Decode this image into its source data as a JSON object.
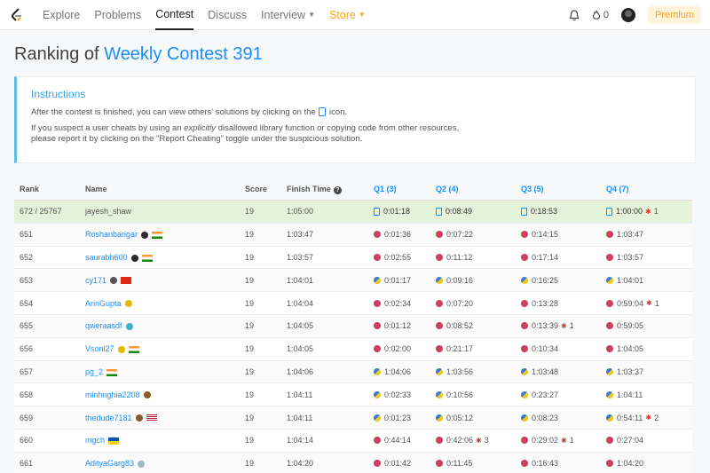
{
  "nav": {
    "items": [
      {
        "label": "Explore",
        "active": false
      },
      {
        "label": "Problems",
        "active": false
      },
      {
        "label": "Contest",
        "active": true
      },
      {
        "label": "Discuss",
        "active": false
      },
      {
        "label": "Interview",
        "dropdown": true
      },
      {
        "label": "Store",
        "dropdown": true
      }
    ],
    "fire_count": "0",
    "premium_label": "Premium"
  },
  "page": {
    "title_prefix": "Ranking of ",
    "contest_name": "Weekly Contest 391"
  },
  "instructions": {
    "heading": "Instructions",
    "line1_before": "After the contest is finished, you can view others' solutions by clicking on the ",
    "line1_after": " icon.",
    "line2_before": "If you suspect a user cheats by using an ",
    "line2_em": "explicitly",
    "line2_after": " disallowed library function or copying code from other resources,",
    "line3": "please report it by clicking on the \"Report Cheating\" toggle under the suspicious solution."
  },
  "table": {
    "headers": {
      "rank": "Rank",
      "name": "Name",
      "score": "Score",
      "finish": "Finish Time",
      "q1": "Q1 (3)",
      "q2": "Q2 (4)",
      "q3": "Q3 (5)",
      "q4": "Q4 (7)"
    },
    "rows": [
      {
        "rank": "672 / 25767",
        "name": "jayesh_shaw",
        "me": true,
        "score": "19",
        "finish": "1:05:00",
        "q1": {
          "t": "0:01:18",
          "lang": "doc"
        },
        "q2": {
          "t": "0:08:49",
          "lang": "doc"
        },
        "q3": {
          "t": "0:18:53",
          "lang": "doc"
        },
        "q4": {
          "t": "1:00:00",
          "lang": "doc",
          "bugs": "1"
        }
      },
      {
        "rank": "651",
        "name": "Roshanbangar",
        "badge": "#2c2c2c",
        "flag": "in",
        "score": "19",
        "finish": "1:03:47",
        "q1": {
          "t": "0:01:36",
          "lang": "cpp"
        },
        "q2": {
          "t": "0:07:22",
          "lang": "cpp"
        },
        "q3": {
          "t": "0:14:15",
          "lang": "cpp"
        },
        "q4": {
          "t": "1:03:47",
          "lang": "cpp"
        }
      },
      {
        "rank": "652",
        "name": "saurabh600",
        "badge": "#2c2c2c",
        "flag": "in",
        "score": "19",
        "finish": "1:03:57",
        "q1": {
          "t": "0:02:55",
          "lang": "cpp"
        },
        "q2": {
          "t": "0:11:12",
          "lang": "cpp"
        },
        "q3": {
          "t": "0:17:14",
          "lang": "cpp"
        },
        "q4": {
          "t": "1:03:57",
          "lang": "cpp"
        }
      },
      {
        "rank": "653",
        "name": "cy171",
        "badge": "#555",
        "flag": "cn",
        "score": "19",
        "finish": "1:04:01",
        "q1": {
          "t": "0:01:17",
          "lang": "py"
        },
        "q2": {
          "t": "0:09:16",
          "lang": "py"
        },
        "q3": {
          "t": "0:16:25",
          "lang": "py"
        },
        "q4": {
          "t": "1:04:01",
          "lang": "py"
        }
      },
      {
        "rank": "654",
        "name": "ArinGupta",
        "badge": "#e6b800",
        "flag": "",
        "score": "19",
        "finish": "1:04:04",
        "q1": {
          "t": "0:02:34",
          "lang": "cpp"
        },
        "q2": {
          "t": "0:07:20",
          "lang": "cpp"
        },
        "q3": {
          "t": "0:13:28",
          "lang": "cpp"
        },
        "q4": {
          "t": "0:59:04",
          "lang": "cpp",
          "bugs": "1"
        }
      },
      {
        "rank": "655",
        "name": "qweraasdf",
        "badge": "#3ab0c9",
        "flag": "",
        "score": "19",
        "finish": "1:04:05",
        "q1": {
          "t": "0:01:12",
          "lang": "cpp"
        },
        "q2": {
          "t": "0:08:52",
          "lang": "cpp"
        },
        "q3": {
          "t": "0:13:39",
          "lang": "cpp",
          "bugs": "1"
        },
        "q4": {
          "t": "0:59:05",
          "lang": "cpp"
        }
      },
      {
        "rank": "656",
        "name": "Vsoni27",
        "badge": "#e6b800",
        "flag": "in",
        "score": "19",
        "finish": "1:04:05",
        "q1": {
          "t": "0:02:00",
          "lang": "cpp"
        },
        "q2": {
          "t": "0:21:17",
          "lang": "cpp"
        },
        "q3": {
          "t": "0:10:34",
          "lang": "cpp"
        },
        "q4": {
          "t": "1:04:05",
          "lang": "cpp"
        }
      },
      {
        "rank": "657",
        "name": "pg_2",
        "badge": "",
        "flag": "in",
        "score": "19",
        "finish": "1:04:06",
        "q1": {
          "t": "1:04:06",
          "lang": "py"
        },
        "q2": {
          "t": "1:03:56",
          "lang": "py"
        },
        "q3": {
          "t": "1:03:48",
          "lang": "py"
        },
        "q4": {
          "t": "1:03:37",
          "lang": "py"
        }
      },
      {
        "rank": "658",
        "name": "minhnghia2208",
        "badge": "#8a5a2b",
        "flag": "",
        "score": "19",
        "finish": "1:04:11",
        "q1": {
          "t": "0:02:33",
          "lang": "py"
        },
        "q2": {
          "t": "0:10:56",
          "lang": "py"
        },
        "q3": {
          "t": "0:23:27",
          "lang": "py"
        },
        "q4": {
          "t": "1:04:11",
          "lang": "py"
        }
      },
      {
        "rank": "659",
        "name": "thedude7181",
        "badge": "#8a5a2b",
        "flag": "us",
        "score": "19",
        "finish": "1:04:11",
        "q1": {
          "t": "0:01:23",
          "lang": "py"
        },
        "q2": {
          "t": "0:05:12",
          "lang": "py"
        },
        "q3": {
          "t": "0:08:23",
          "lang": "py"
        },
        "q4": {
          "t": "0:54:11",
          "lang": "py",
          "bugs": "2"
        }
      },
      {
        "rank": "660",
        "name": "mgch",
        "badge": "",
        "flag": "ua",
        "score": "19",
        "finish": "1:04:14",
        "q1": {
          "t": "0:44:14",
          "lang": "cpp"
        },
        "q2": {
          "t": "0:42:06",
          "lang": "cpp",
          "bugs": "3"
        },
        "q3": {
          "t": "0:29:02",
          "lang": "cpp",
          "bugs": "1"
        },
        "q4": {
          "t": "0:27:04",
          "lang": "cpp"
        }
      },
      {
        "rank": "661",
        "name": "AdityaGarg83",
        "badge": "#9bb",
        "flag": "",
        "score": "19",
        "finish": "1:04:20",
        "q1": {
          "t": "0:01:42",
          "lang": "cpp"
        },
        "q2": {
          "t": "0:11:45",
          "lang": "cpp"
        },
        "q3": {
          "t": "0:16:43",
          "lang": "cpp"
        },
        "q4": {
          "t": "1:04:20",
          "lang": "cpp"
        }
      }
    ]
  },
  "colors": {
    "accent": "#1a90ff",
    "store": "#ffa116",
    "instructions": "#31a4e8",
    "me_row": "#e3f2d8",
    "bug": "#d9362b",
    "cpp": "#c9415e",
    "py": "#3a7bd5"
  }
}
